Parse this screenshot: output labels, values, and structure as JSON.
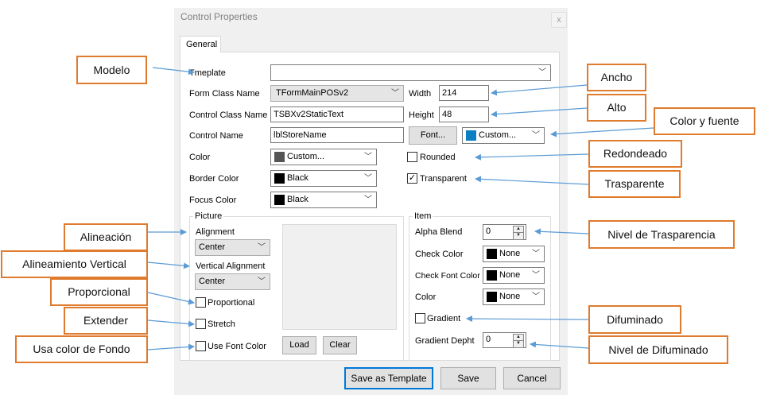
{
  "dialog": {
    "title": "Control Properties",
    "close_label": "x",
    "tab_label": "General"
  },
  "form": {
    "template_label": "Tmeplate",
    "template_value": "",
    "form_class_label": "Form Class Name",
    "form_class_value": "TFormMainPOSv2",
    "control_class_label": "Control Class Name",
    "control_class_value": "TSBXv2StaticText",
    "control_name_label": "Control Name",
    "control_name_value": "lblStoreName",
    "width_label": "Width",
    "width_value": "214",
    "height_label": "Height",
    "height_value": "48",
    "font_button": "Font...",
    "font_color": {
      "text": "Custom...",
      "swatch": "#0a7fc2"
    },
    "color_label": "Color",
    "color_value": {
      "text": "Custom...",
      "swatch": "#555555"
    },
    "border_color_label": "Border Color",
    "border_color_value": {
      "text": "Black",
      "swatch": "#000000"
    },
    "focus_color_label": "Focus Color",
    "focus_color_value": {
      "text": "Black",
      "swatch": "#000000"
    },
    "rounded_label": "Rounded",
    "rounded_checked": false,
    "transparent_label": "Transparent",
    "transparent_checked": true
  },
  "picture": {
    "title": "Picture",
    "alignment_label": "Alignment",
    "alignment_value": "Center",
    "vertical_alignment_label": "Vertical Alignment",
    "vertical_alignment_value": "Center",
    "proportional_label": "Proportional",
    "stretch_label": "Stretch",
    "use_font_color_label": "Use Font Color",
    "load_button": "Load",
    "clear_button": "Clear"
  },
  "item": {
    "title": "Item",
    "alpha_blend_label": "Alpha Blend",
    "alpha_blend_value": "0",
    "check_color_label": "Check Color",
    "check_color_value": {
      "text": "None",
      "swatch": "#000000"
    },
    "check_font_color_label": "Check Font Color",
    "check_font_color_value": {
      "text": "None",
      "swatch": "#000000"
    },
    "color_label": "Color",
    "color_value": {
      "text": "None",
      "swatch": "#000000"
    },
    "gradient_label": "Gradient",
    "gradient_depth_label": "Gradient Depht",
    "gradient_depth_value": "0"
  },
  "footer": {
    "save_template": "Save as Template",
    "save": "Save",
    "cancel": "Cancel"
  },
  "callouts": {
    "modelo": "Modelo",
    "ancho": "Ancho",
    "alto": "Alto",
    "color_fuente": "Color y fuente",
    "redondeado": "Redondeado",
    "trasparente": "Trasparente",
    "alineacion": "Alineación",
    "alineamiento_vertical": "Alineamiento Vertical",
    "proporcional": "Proporcional",
    "extender": "Extender",
    "usa_color_fondo": "Usa color de Fondo",
    "nivel_trasparencia": "Nivel de Trasparencia",
    "difuminado": "Difuminado",
    "nivel_difuminado": "Nivel de Difuminado"
  },
  "colors": {
    "callout_border": "#e07a2c",
    "arrow": "#5b9bd5",
    "primary_button_border": "#0078d7"
  }
}
